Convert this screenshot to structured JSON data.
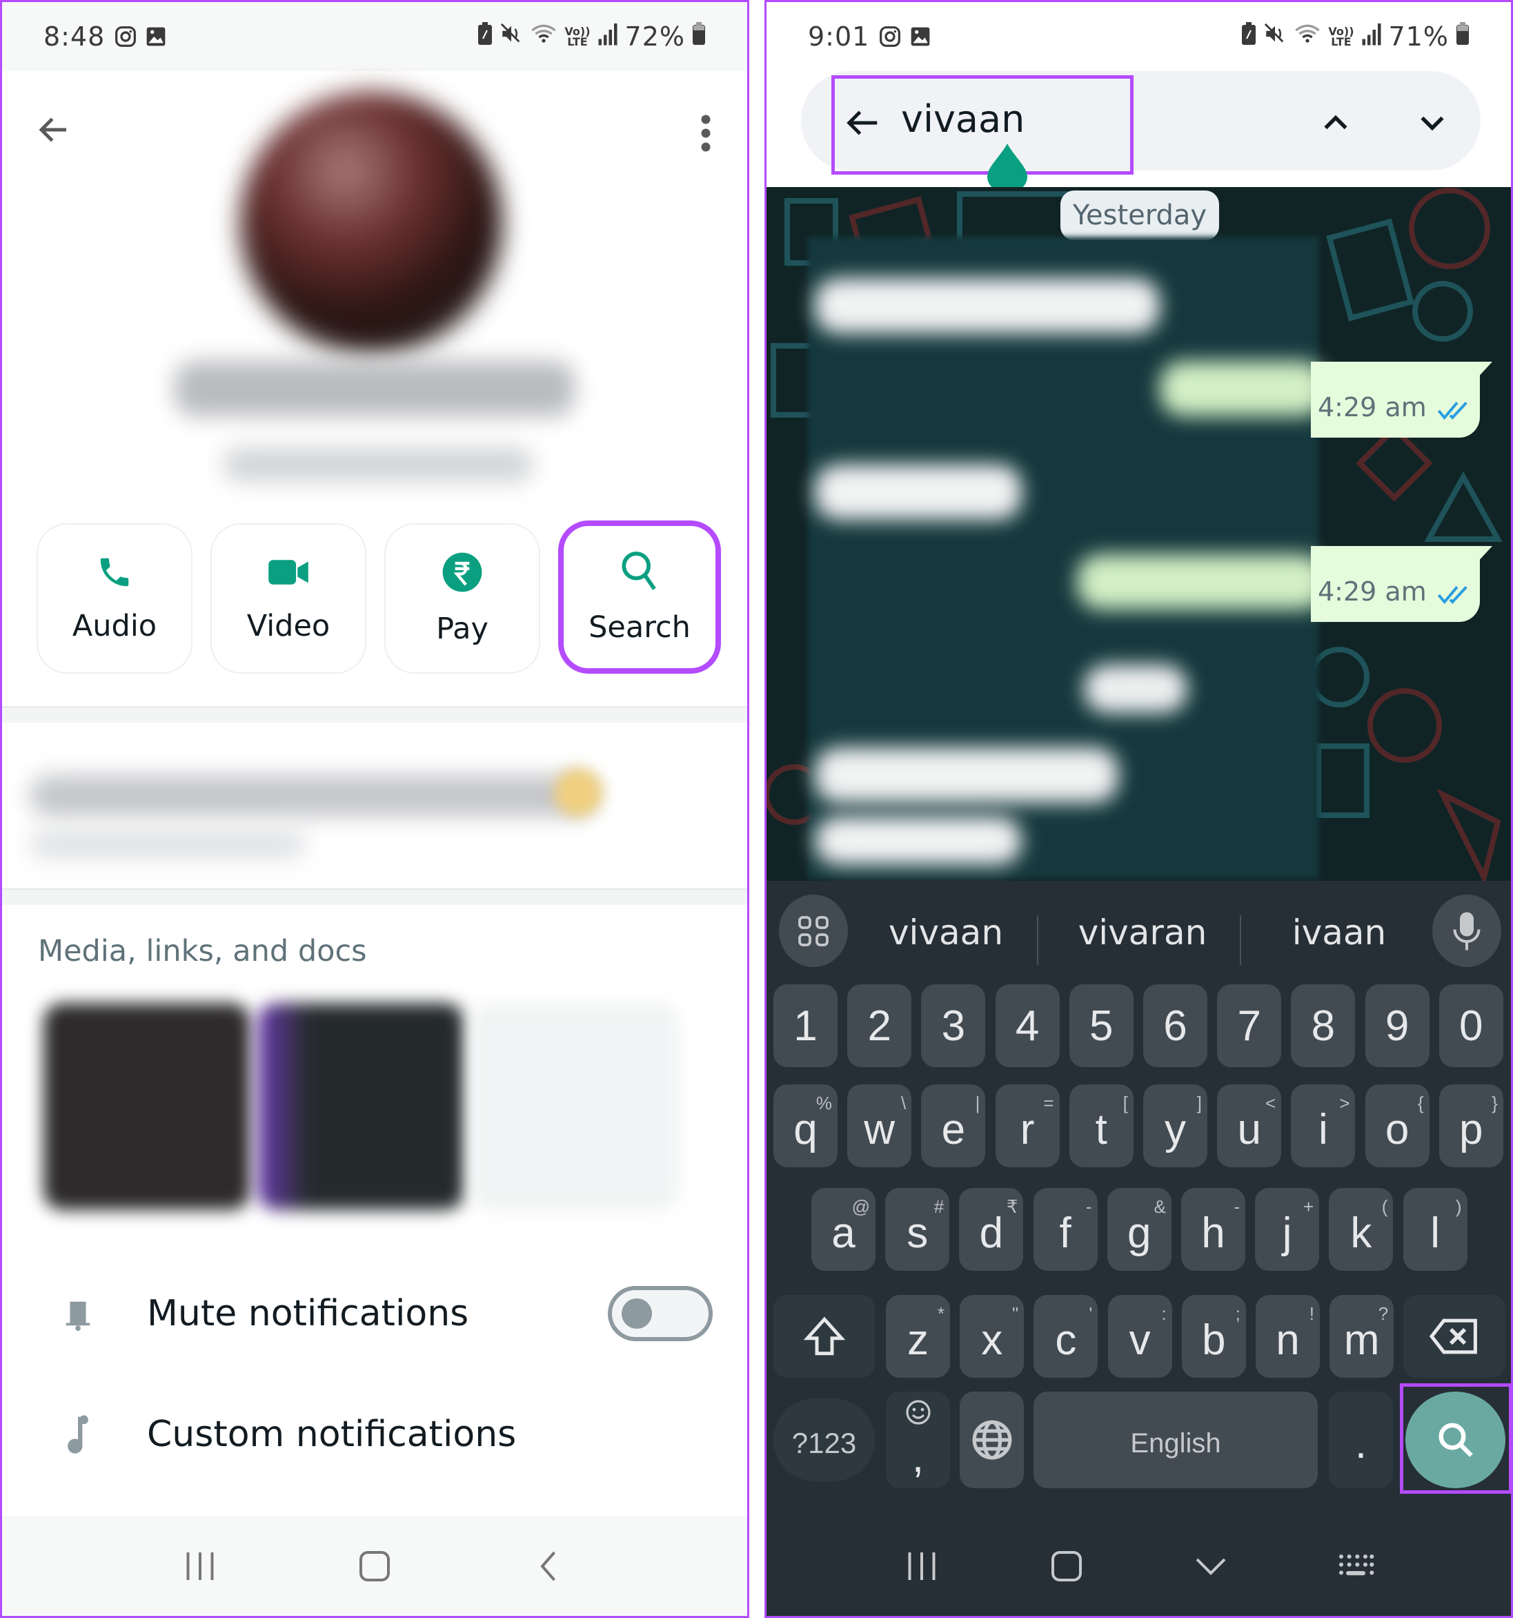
{
  "left_screen": {
    "status_bar": {
      "time": "8:48",
      "notification_icons": [
        "instagram-icon",
        "gallery-icon"
      ],
      "system_icons": [
        "battery-saver-icon",
        "mute-icon",
        "wifi-icon",
        "volte-lte-icon",
        "signal-icon"
      ],
      "battery": "72%"
    },
    "header": {
      "back_icon": "arrow-left-icon",
      "menu_icon": "more-vert-icon"
    },
    "actions": [
      {
        "label": "Audio",
        "icon": "phone-icon"
      },
      {
        "label": "Video",
        "icon": "video-camera-icon"
      },
      {
        "label": "Pay",
        "icon": "rupee-icon"
      },
      {
        "label": "Search",
        "icon": "search-icon",
        "highlighted": true
      }
    ],
    "media_section": {
      "title": "Media, links, and docs"
    },
    "settings": [
      {
        "label": "Mute notifications",
        "icon": "bell-icon",
        "toggle": false
      },
      {
        "label": "Custom notifications",
        "icon": "music-note-icon"
      }
    ],
    "nav": [
      "recents-icon",
      "home-icon",
      "back-icon"
    ]
  },
  "right_screen": {
    "status_bar": {
      "time": "9:01",
      "notification_icons": [
        "instagram-icon",
        "gallery-icon"
      ],
      "system_icons": [
        "battery-saver-icon",
        "mute-icon",
        "wifi-icon",
        "volte-lte-icon",
        "signal-icon"
      ],
      "battery": "71%"
    },
    "search": {
      "query": "vivaan",
      "back_icon": "arrow-left-icon",
      "prev_icon": "chevron-up-icon",
      "next_icon": "chevron-down-icon"
    },
    "chat": {
      "date_label": "Yesterday",
      "outgoing": [
        {
          "time": "4:29 am",
          "status": "read"
        },
        {
          "time": "4:29 am",
          "status": "read"
        }
      ]
    },
    "keyboard": {
      "suggestions": [
        "vivaan",
        "vivaran",
        "ivaan"
      ],
      "number_row": [
        "1",
        "2",
        "3",
        "4",
        "5",
        "6",
        "7",
        "8",
        "9",
        "0"
      ],
      "row1": [
        {
          "k": "q",
          "s": "%"
        },
        {
          "k": "w",
          "s": "\\"
        },
        {
          "k": "e",
          "s": "|"
        },
        {
          "k": "r",
          "s": "="
        },
        {
          "k": "t",
          "s": "["
        },
        {
          "k": "y",
          "s": "]"
        },
        {
          "k": "u",
          "s": "<"
        },
        {
          "k": "i",
          "s": ">"
        },
        {
          "k": "o",
          "s": "{"
        },
        {
          "k": "p",
          "s": "}"
        }
      ],
      "row2": [
        {
          "k": "a",
          "s": "@"
        },
        {
          "k": "s",
          "s": "#"
        },
        {
          "k": "d",
          "s": "₹"
        },
        {
          "k": "f",
          "s": "-"
        },
        {
          "k": "g",
          "s": "&"
        },
        {
          "k": "h",
          "s": "-"
        },
        {
          "k": "j",
          "s": "+"
        },
        {
          "k": "k",
          "s": "("
        },
        {
          "k": "l",
          "s": ")"
        }
      ],
      "row3": [
        {
          "k": "z",
          "s": "*"
        },
        {
          "k": "x",
          "s": "\""
        },
        {
          "k": "c",
          "s": "'"
        },
        {
          "k": "v",
          "s": ":"
        },
        {
          "k": "b",
          "s": ";"
        },
        {
          "k": "n",
          "s": "!"
        },
        {
          "k": "m",
          "s": "?"
        }
      ],
      "symbols_label": "?123",
      "comma_label": ",",
      "space_label": "English",
      "period_label": ".",
      "action": "search-icon"
    },
    "nav": [
      "recents-icon",
      "home-icon",
      "hide-keyboard-icon",
      "keyboard-icon"
    ]
  },
  "colors": {
    "highlight": "#b44bff",
    "accent_green": "#0a9f80",
    "outgoing_bubble": "#e5fbdc",
    "read_tick": "#2a9ee0",
    "keyboard_bg": "#262f36"
  }
}
